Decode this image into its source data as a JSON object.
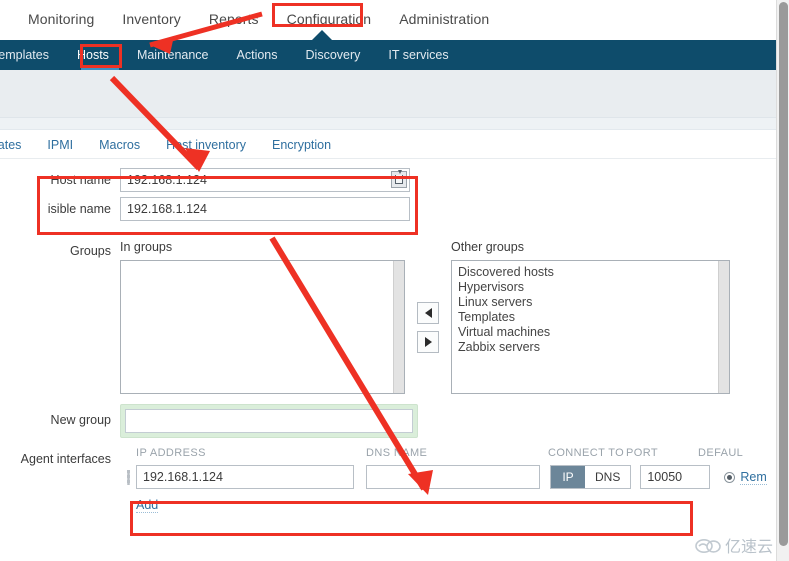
{
  "main_menu": {
    "items": [
      {
        "label": "Monitoring",
        "active": false
      },
      {
        "label": "Inventory",
        "active": false
      },
      {
        "label": "Reports",
        "active": false
      },
      {
        "label": "Configuration",
        "active": true
      },
      {
        "label": "Administration",
        "active": false
      }
    ]
  },
  "sub_menu": {
    "items": [
      {
        "label": "Templates",
        "active": false
      },
      {
        "label": "Hosts",
        "active": true
      },
      {
        "label": "Maintenance",
        "active": false
      },
      {
        "label": "Actions",
        "active": false
      },
      {
        "label": "Discovery",
        "active": false
      },
      {
        "label": "IT services",
        "active": false
      }
    ]
  },
  "form_tabs": {
    "items": [
      {
        "label": "lates"
      },
      {
        "label": "IPMI"
      },
      {
        "label": "Macros"
      },
      {
        "label": "Host inventory"
      },
      {
        "label": "Encryption"
      }
    ]
  },
  "form": {
    "host_name": {
      "label": "Host name",
      "value": "192.168.1.124",
      "placeholder": ""
    },
    "visible_name": {
      "label": "isible name",
      "value": "192.168.1.124",
      "placeholder": ""
    },
    "groups": {
      "label": "Groups",
      "in_groups_caption": "In groups",
      "in_groups": [],
      "other_groups_caption": "Other groups",
      "other_groups": [
        "Discovered hosts",
        "Hypervisors",
        "Linux servers",
        "Templates",
        "Virtual machines",
        "Zabbix servers"
      ],
      "move_left_icon": "arrow-left-icon",
      "move_right_icon": "arrow-right-icon"
    },
    "new_group": {
      "label": "New group",
      "value": "",
      "placeholder": ""
    },
    "agent_interfaces": {
      "label": "Agent interfaces",
      "columns": {
        "ip": "IP ADDRESS",
        "dns": "DNS NAME",
        "connect_to": "CONNECT TO",
        "port": "PORT",
        "default": "DEFAUL"
      },
      "rows": [
        {
          "ip_value": "192.168.1.124",
          "dns_value": "",
          "connect_to_selected": "IP",
          "connect_to_options": [
            "IP",
            "DNS"
          ],
          "port_value": "10050",
          "default_label": "Rem"
        }
      ],
      "add_label": "Add"
    }
  },
  "watermark": {
    "text": "亿速云"
  },
  "colors": {
    "nav_dark": "#0e4c6b",
    "accent_blue": "#3c8fc4",
    "link_blue": "#2f6f9f",
    "annotation_red": "#ee3124",
    "toggle_active": "#6c8699",
    "new_group_highlight": "#daeeda"
  }
}
